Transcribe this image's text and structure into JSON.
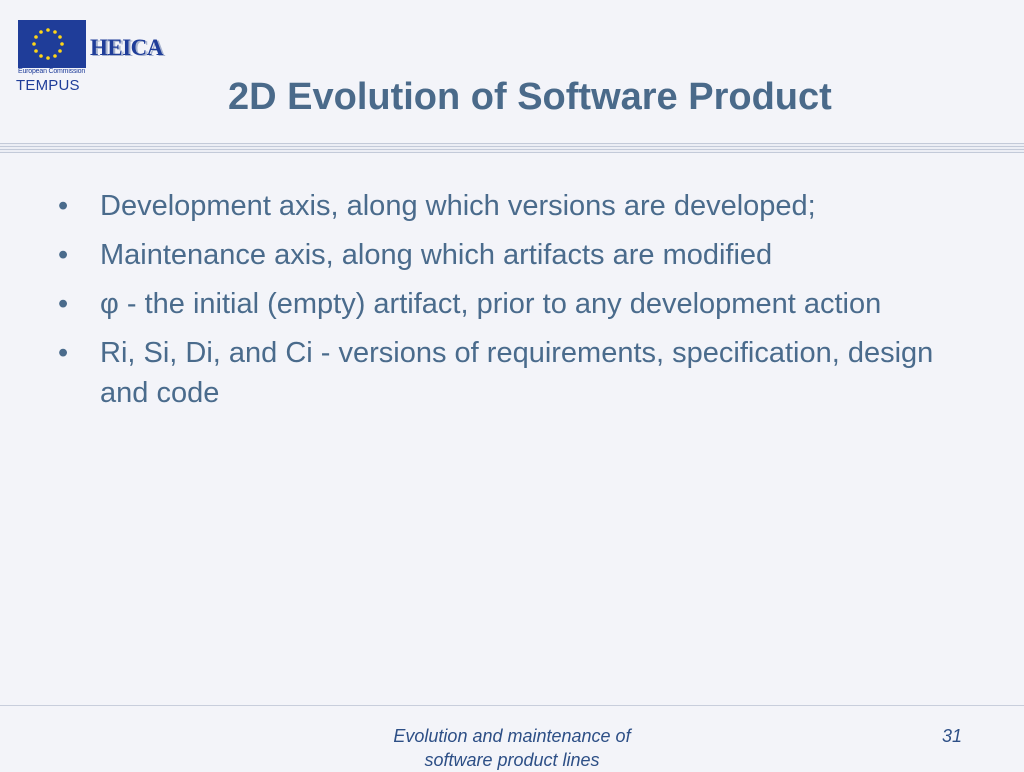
{
  "logo": {
    "commission": "European Commission",
    "program": "TEMPUS",
    "project": "HEICA"
  },
  "slide": {
    "title": "2D Evolution of Software Product",
    "bullets": [
      "Development axis, along which versions are developed;",
      "Maintenance axis, along which artifacts are modified",
      "φ - the initial (empty) artifact, prior to any development action",
      "Ri, Si, Di, and Ci - versions of requirements, specification, design and code"
    ],
    "bullet_symbol": "•"
  },
  "footer": {
    "caption": "Evolution and maintenance of software product lines",
    "page_number": "31"
  },
  "colors": {
    "background": "#f3f4f9",
    "title": "#4a6a8a",
    "body_text": "#4a6b8c",
    "footer_text": "#2d4f86",
    "eu_blue": "#1f3d99",
    "eu_star": "#ffd617"
  }
}
